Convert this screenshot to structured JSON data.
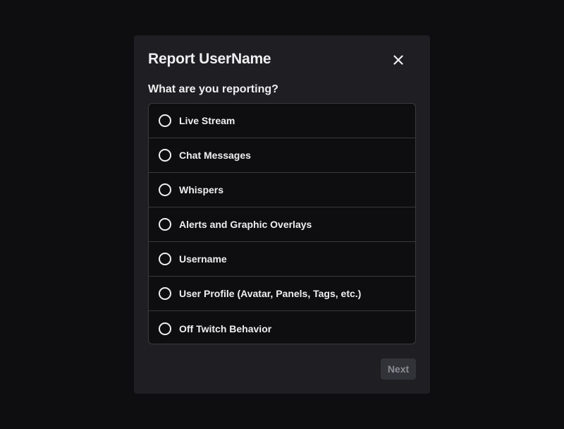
{
  "modal": {
    "title": "Report UserName",
    "question": "What are you reporting?",
    "options": [
      {
        "label": "Live Stream"
      },
      {
        "label": "Chat Messages"
      },
      {
        "label": "Whispers"
      },
      {
        "label": "Alerts and Graphic Overlays"
      },
      {
        "label": "Username"
      },
      {
        "label": "User Profile (Avatar, Panels, Tags, etc.)"
      },
      {
        "label": "Off Twitch Behavior"
      }
    ],
    "next_label": "Next",
    "close_icon": "close-icon"
  },
  "colors": {
    "page_background": "#0e0e10",
    "modal_background": "#1f1f23",
    "text": "#efeff1",
    "border": "#3a3a3d",
    "disabled_button_bg": "#323239",
    "disabled_button_text": "#8b8b92"
  }
}
